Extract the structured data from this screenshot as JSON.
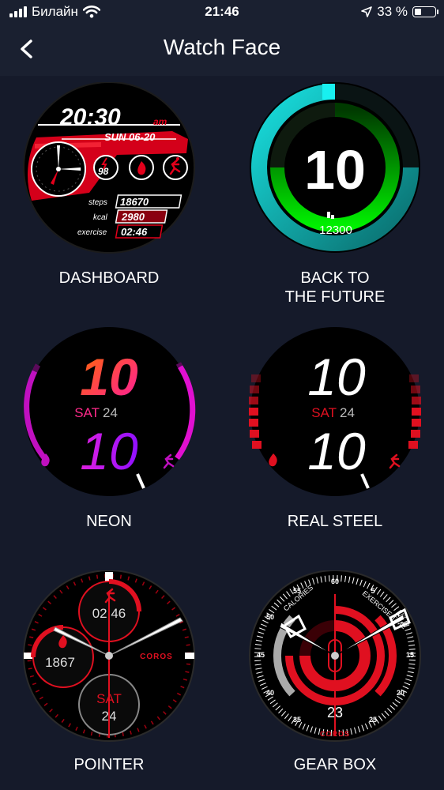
{
  "status_bar": {
    "carrier": "Билайн",
    "time": "21:46",
    "battery_text": "33 %",
    "battery_level": 0.33
  },
  "header": {
    "title": "Watch Face",
    "back_icon": "chevron-left-icon"
  },
  "faces": [
    {
      "label": "DASHBOARD",
      "time": "20:30",
      "ampm": "am",
      "date": "SUN 06-20",
      "gauge_value": "98",
      "steps_label": "steps",
      "steps_value": "18670",
      "kcal_label": "kcal",
      "kcal_value": "2980",
      "exercise_label": "exercise",
      "exercise_value": "02:46",
      "colors": {
        "accent": "#e3001b"
      }
    },
    {
      "label_line1": "BACK TO",
      "label_line2": "THE FUTURE",
      "hour": "10",
      "steps": "12300",
      "colors": {
        "ring": "#18c9c9",
        "inner": "#00e000"
      }
    },
    {
      "label": "NEON",
      "hour": "10",
      "minute": "10",
      "day": "SAT",
      "date": "24",
      "colors": {
        "top": "#ff5a1f",
        "bottom": "#b020ff"
      }
    },
    {
      "label": "REAL STEEL",
      "hour": "10",
      "minute": "10",
      "day": "SAT",
      "date": "24",
      "colors": {
        "accent": "#e01020"
      }
    },
    {
      "label": "POINTER",
      "exercise_time": "02:46",
      "calories": "1867",
      "day": "SAT",
      "date": "24",
      "brand": "COROS",
      "colors": {
        "accent": "#e01020"
      }
    },
    {
      "label": "GEAR BOX",
      "date": "23",
      "brand": "COROS",
      "left_label": "CALORIES",
      "right_label": "EXERCISE TIME",
      "dial_numbers": [
        "60",
        "55",
        "5",
        "50",
        "10",
        "45",
        "15",
        "40",
        "20",
        "35",
        "25"
      ],
      "colors": {
        "accent": "#e01020"
      }
    }
  ]
}
